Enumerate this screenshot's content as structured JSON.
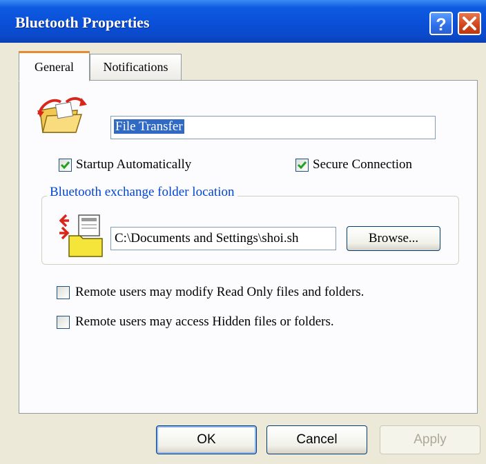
{
  "window": {
    "title": "Bluetooth Properties"
  },
  "titlebar": {
    "help_icon": "help-icon",
    "close_icon": "close-icon"
  },
  "tabs": [
    {
      "label": "General",
      "selected": true
    },
    {
      "label": "Notifications",
      "selected": false
    }
  ],
  "general": {
    "service_icon": "file-transfer-icon",
    "service_name": "File Transfer",
    "startup_label": "Startup Automatically",
    "startup_checked": true,
    "secure_label": "Secure Connection",
    "secure_checked": true,
    "folder_group_label": "Bluetooth exchange folder location",
    "folder_icon": "exchange-folder-icon",
    "folder_path": "C:\\Documents and Settings\\shoi.sh",
    "browse_label": "Browse...",
    "readonly_label": "Remote users may modify Read Only files and folders.",
    "readonly_checked": false,
    "hidden_label": "Remote users may access Hidden files or folders.",
    "hidden_checked": false
  },
  "buttons": {
    "ok": "OK",
    "cancel": "Cancel",
    "apply": "Apply"
  },
  "colors": {
    "titlebar": "#0a4fd8",
    "accent_tab": "#e68b2c",
    "group_label": "#0046d5",
    "check": "#21a121"
  }
}
